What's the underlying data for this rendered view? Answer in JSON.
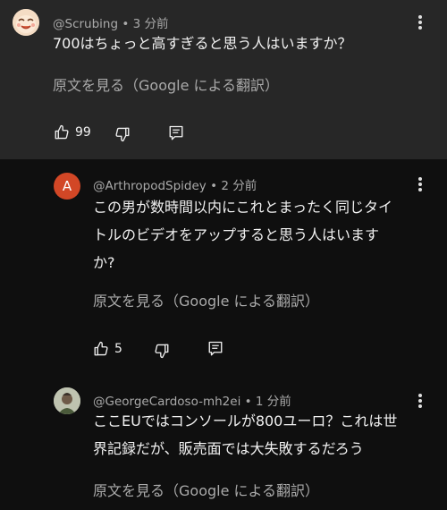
{
  "comments": [
    {
      "author": "@Scrubing",
      "time": "3 分前",
      "text": "700はちょっと高すぎると思う人はいますか？",
      "translate_label": "原文を見る（Google による翻訳）",
      "likes": "99"
    },
    {
      "avatar_letter": "A",
      "author": "@ArthropodSpidey",
      "time": "2 分前",
      "text_lines": [
        "この男が数時間以内にこれとまったく同じタイ",
        "トルのビデオをアップすると思う人はいます",
        "か?"
      ],
      "translate_label": "原文を見る（Google による翻訳）",
      "likes": "5"
    },
    {
      "author": "@GeorgeCardoso-mh2ei",
      "time": "1 分前",
      "text_lines": [
        "ここEUではコンソールが800ユーロ？これは世",
        "界記録だが、販売面では大失敗するだろう"
      ],
      "translate_label": "原文を見る（Google による翻訳）"
    }
  ],
  "separator": " • ",
  "icons": {
    "like": "thumb-up-icon",
    "dislike": "thumb-down-icon",
    "reply": "reply-icon",
    "more": "more-vert-icon"
  },
  "colors": {
    "top_comment_bg": "#272727",
    "page_bg": "#0f0f0f",
    "secondary_text": "#aaaaaa",
    "avatar_a_bg": "#d24726"
  }
}
